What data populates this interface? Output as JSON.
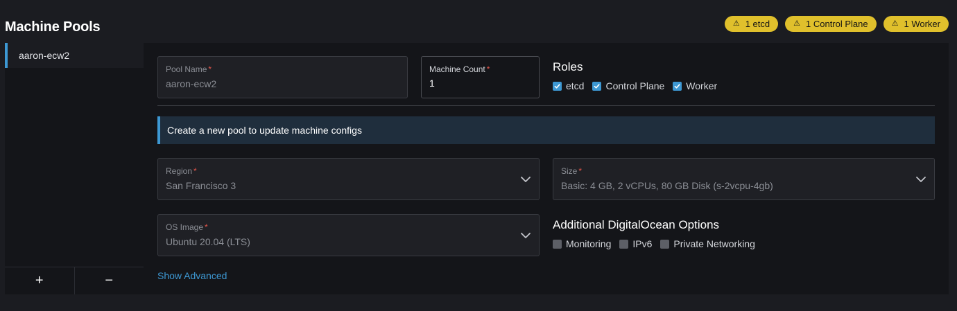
{
  "page": {
    "title": "Machine Pools"
  },
  "badges": [
    {
      "label": "1 etcd"
    },
    {
      "label": "1 Control Plane"
    },
    {
      "label": "1 Worker"
    }
  ],
  "sidebar": {
    "items": [
      {
        "label": "aaron-ecw2"
      }
    ],
    "add_label": "+",
    "remove_label": "−"
  },
  "form": {
    "pool_name": {
      "label": "Pool Name",
      "required": "*",
      "value": "aaron-ecw2"
    },
    "machine_count": {
      "label": "Machine Count",
      "required": "*",
      "value": "1"
    },
    "roles": {
      "heading": "Roles",
      "options": [
        {
          "label": "etcd",
          "checked": true
        },
        {
          "label": "Control Plane",
          "checked": true
        },
        {
          "label": "Worker",
          "checked": true
        }
      ]
    },
    "banner": "Create a new pool to update machine configs",
    "region": {
      "label": "Region",
      "required": "*",
      "value": "San Francisco 3"
    },
    "size": {
      "label": "Size",
      "required": "*",
      "value": "Basic: 4 GB, 2 vCPUs, 80 GB Disk (s-2vcpu-4gb)"
    },
    "os_image": {
      "label": "OS Image",
      "required": "*",
      "value": "Ubuntu 20.04 (LTS)"
    },
    "additional": {
      "heading": "Additional DigitalOcean Options",
      "options": [
        {
          "label": "Monitoring",
          "checked": false
        },
        {
          "label": "IPv6",
          "checked": false
        },
        {
          "label": "Private Networking",
          "checked": false
        }
      ]
    },
    "show_advanced": "Show Advanced"
  },
  "colors": {
    "accent": "#3d98d3",
    "warning_badge": "#e0c02c",
    "required": "#e2554a",
    "background": "#1b1c21",
    "panel": "#141519"
  },
  "icons": {
    "badge": "warning-icon",
    "select": "chevron-down-icon",
    "checked": "checkmark-icon"
  }
}
